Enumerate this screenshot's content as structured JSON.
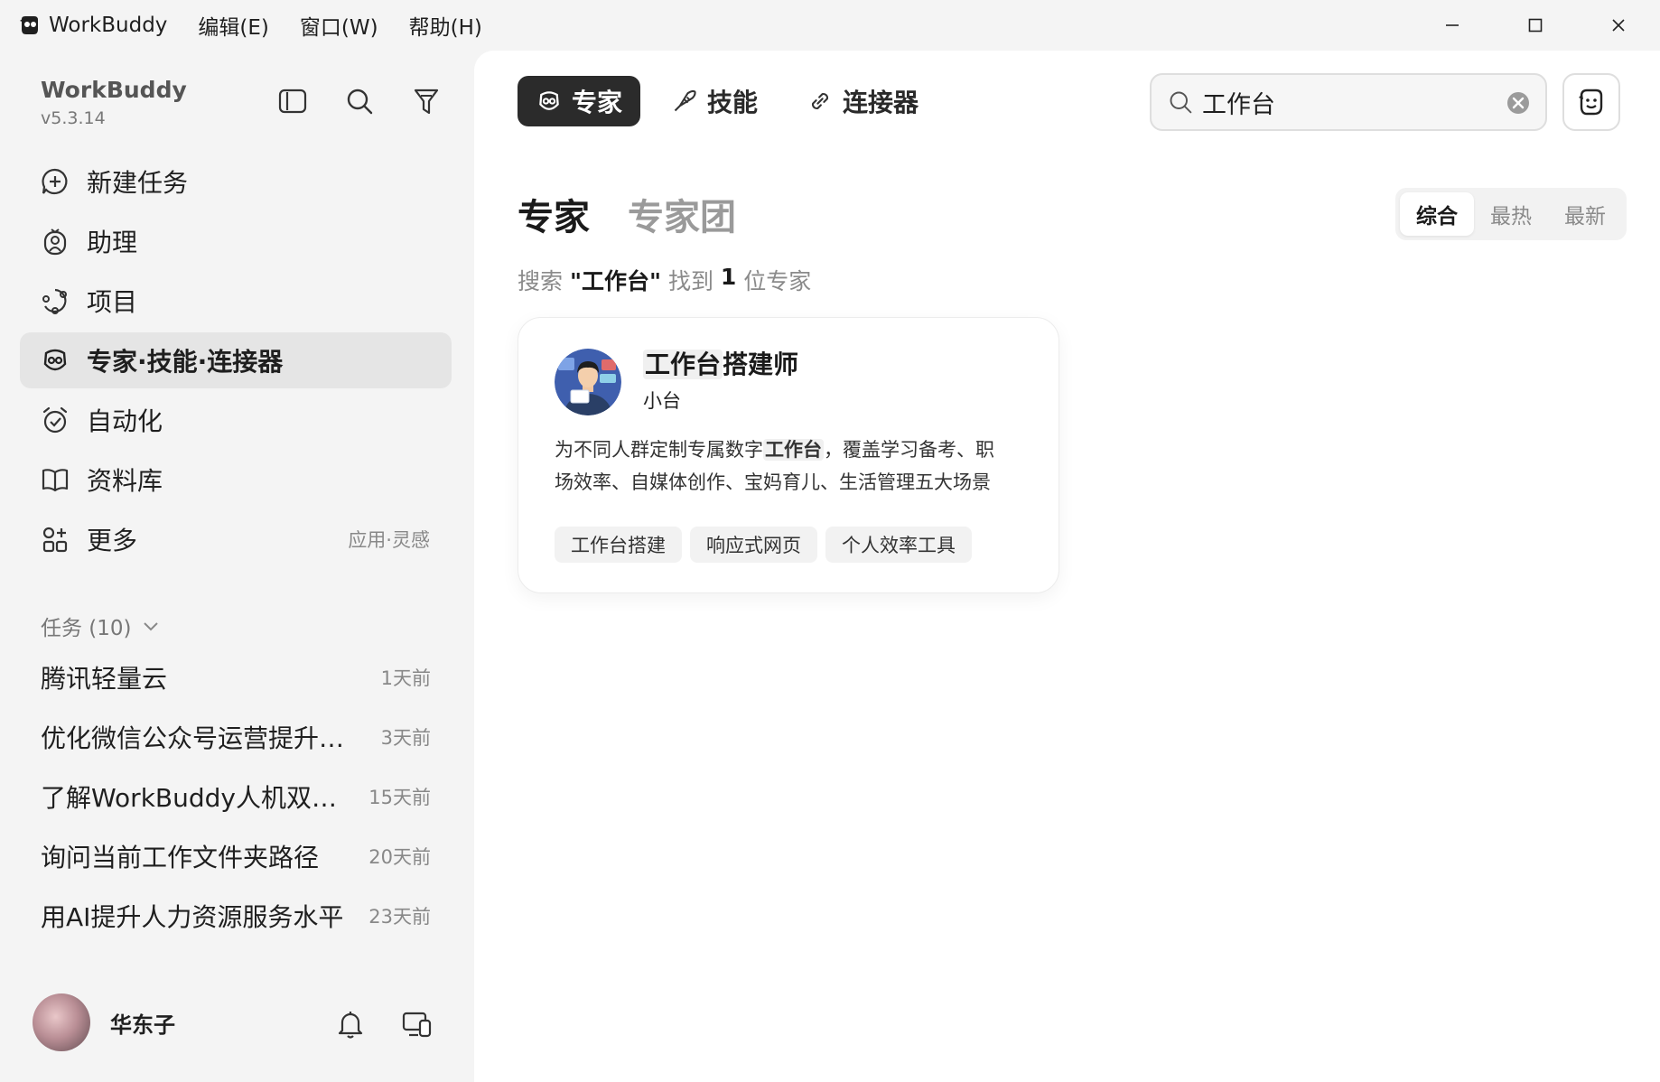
{
  "window": {
    "app_name": "WorkBuddy",
    "menu": [
      "编辑(E)",
      "窗口(W)",
      "帮助(H)"
    ]
  },
  "sidebar": {
    "brand": {
      "name": "WorkBuddy",
      "version": "v5.3.14"
    },
    "nav": [
      {
        "label": "新建任务",
        "icon": "plus-circle-icon"
      },
      {
        "label": "助理",
        "icon": "assistant-icon"
      },
      {
        "label": "项目",
        "icon": "project-icon"
      },
      {
        "label": "专家·技能·连接器",
        "icon": "expert-icon",
        "active": true
      },
      {
        "label": "自动化",
        "icon": "alarm-icon"
      },
      {
        "label": "资料库",
        "icon": "book-icon"
      },
      {
        "label": "更多",
        "icon": "apps-icon",
        "hint": "应用·灵感"
      }
    ],
    "tasks_header": "任务 (10)",
    "tasks": [
      {
        "title": "腾讯轻量云",
        "time": "1天前"
      },
      {
        "title": "优化微信公众号运营提升阅读量",
        "time": "3天前"
      },
      {
        "title": "了解WorkBuddy人机双写模式",
        "time": "15天前"
      },
      {
        "title": "询问当前工作文件夹路径",
        "time": "20天前"
      },
      {
        "title": "用AI提升人力资源服务水平",
        "time": "23天前"
      }
    ],
    "user": {
      "name": "华东子"
    }
  },
  "main": {
    "tabs": [
      {
        "label": "专家",
        "icon": "expert-icon",
        "active": true
      },
      {
        "label": "技能",
        "icon": "skill-icon"
      },
      {
        "label": "连接器",
        "icon": "link-icon"
      }
    ],
    "search": {
      "value": "工作台",
      "placeholder": ""
    },
    "section_tabs": [
      "专家",
      "专家团"
    ],
    "sort": [
      "综合",
      "最热",
      "最新"
    ],
    "result": {
      "prefix": "搜索 ",
      "query": "\"工作台\"",
      "mid": " 找到 ",
      "count": "1",
      "suffix": " 位专家"
    },
    "card": {
      "title_hl": "工作台",
      "title_rest": "搭建师",
      "subtitle": "小台",
      "desc_line1_pre": "为不同人群定制专属数字",
      "desc_line1_hl": "工作台",
      "desc_line1_post": "，覆盖学习备考、职",
      "desc_line2": "场效率、自媒体创作、宝妈育儿、生活管理五大场景",
      "tags": [
        "工作台搭建",
        "响应式网页",
        "个人效率工具"
      ]
    }
  },
  "colors": {
    "active_tab_bg": "#2b2b2b",
    "accent_text": "#1a1a1a",
    "muted": "#8a8a8a"
  }
}
